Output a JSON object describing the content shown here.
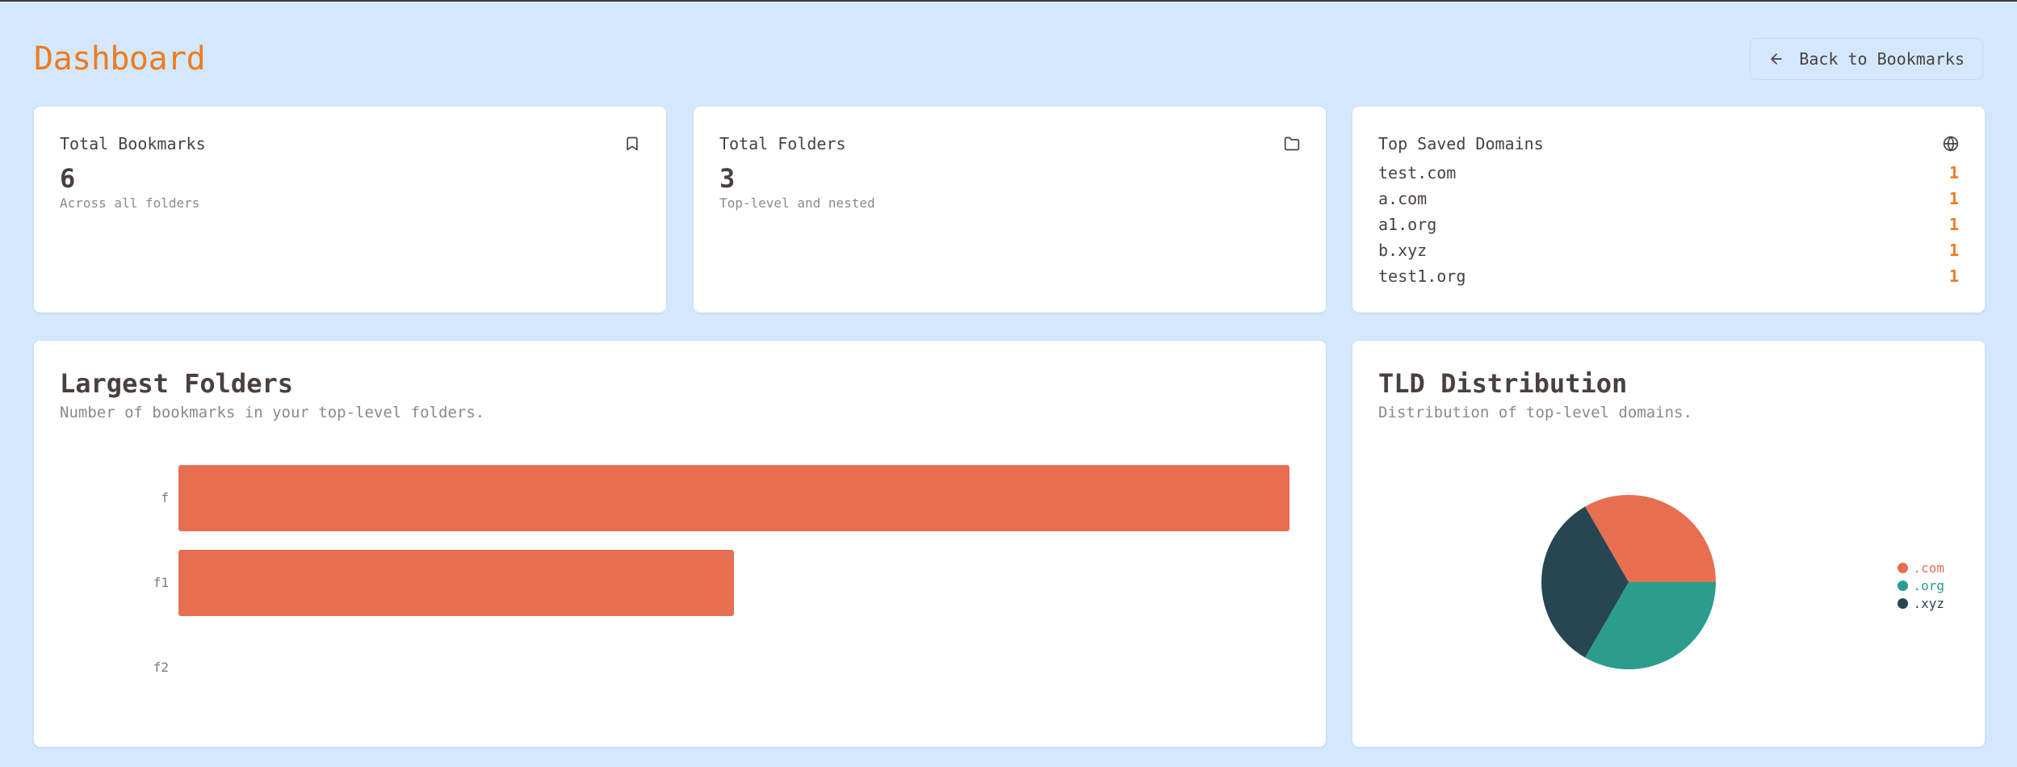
{
  "header": {
    "title": "Dashboard",
    "back_label": "Back to Bookmarks"
  },
  "stats": {
    "bookmarks": {
      "title": "Total Bookmarks",
      "value": "6",
      "sub": "Across all folders",
      "icon": "bookmark-icon"
    },
    "folders": {
      "title": "Total Folders",
      "value": "3",
      "sub": "Top-level and nested",
      "icon": "folder-icon"
    },
    "domains": {
      "title": "Top Saved Domains",
      "icon": "globe-icon",
      "items": [
        {
          "name": "test.com",
          "count": "1"
        },
        {
          "name": "a.com",
          "count": "1"
        },
        {
          "name": "a1.org",
          "count": "1"
        },
        {
          "name": "b.xyz",
          "count": "1"
        },
        {
          "name": "test1.org",
          "count": "1"
        }
      ]
    }
  },
  "largest_folders": {
    "title": "Largest Folders",
    "description": "Number of bookmarks in your top-level folders."
  },
  "tld": {
    "title": "TLD Distribution",
    "description": "Distribution of top-level domains."
  },
  "colors": {
    "accent": "#f07a1e",
    "bar": "#e76e50",
    "com": "#e76e50",
    "org": "#2a9d8f",
    "xyz": "#264653"
  },
  "chart_data": [
    {
      "type": "bar",
      "orientation": "horizontal",
      "categories": [
        "f",
        "f1",
        "f2"
      ],
      "values": [
        2,
        1,
        0
      ],
      "xlim": [
        0,
        2
      ]
    },
    {
      "type": "pie",
      "categories": [
        ".com",
        ".org",
        ".xyz"
      ],
      "values": [
        2,
        2,
        2
      ],
      "legend": "right"
    }
  ]
}
